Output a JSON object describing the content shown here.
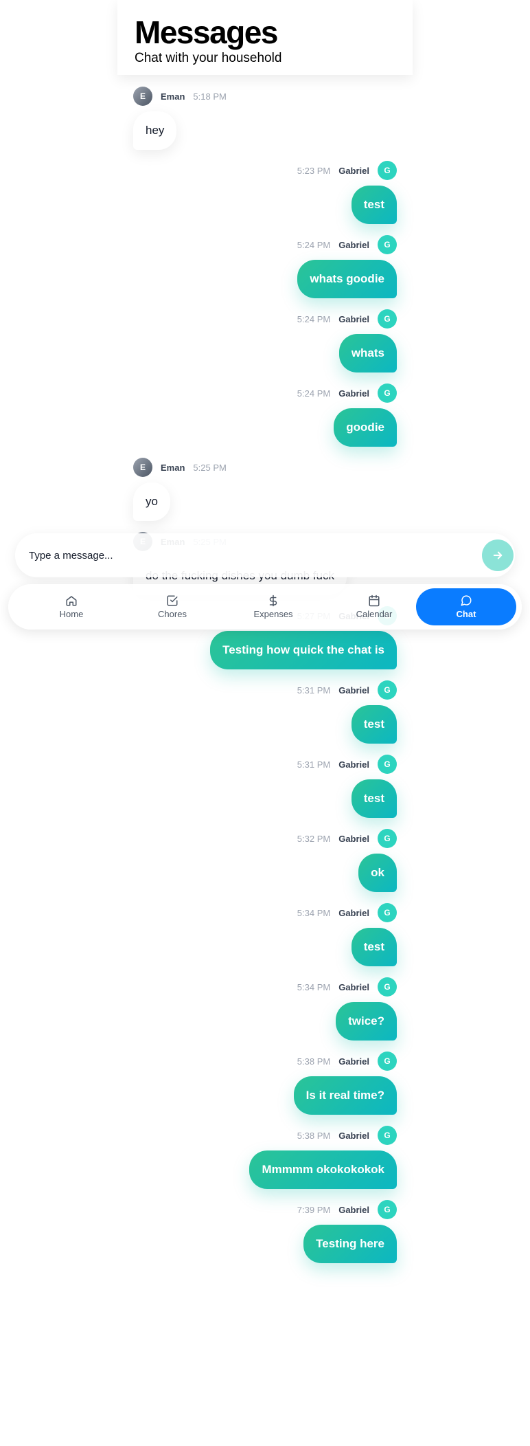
{
  "header": {
    "title": "Messages",
    "subtitle": "Chat with your household"
  },
  "messages": [
    {
      "sender": "Eman",
      "initial": "E",
      "time": "5:18 PM",
      "text": "hey",
      "side": "in"
    },
    {
      "sender": "Gabriel",
      "initial": "G",
      "time": "5:23 PM",
      "text": "test",
      "side": "out"
    },
    {
      "sender": "Gabriel",
      "initial": "G",
      "time": "5:24 PM",
      "text": "whats goodie",
      "side": "out"
    },
    {
      "sender": "Gabriel",
      "initial": "G",
      "time": "5:24 PM",
      "text": "whats",
      "side": "out"
    },
    {
      "sender": "Gabriel",
      "initial": "G",
      "time": "5:24 PM",
      "text": "goodie",
      "side": "out"
    },
    {
      "sender": "Eman",
      "initial": "E",
      "time": "5:25 PM",
      "text": "yo",
      "side": "in"
    },
    {
      "sender": "Eman",
      "initial": "E",
      "time": "5:25 PM",
      "text": "do the fucking dishes you dumb fuck",
      "side": "in"
    },
    {
      "sender": "Gabriel",
      "initial": "G",
      "time": "5:27 PM",
      "text": "Testing how quick the chat is",
      "side": "out"
    },
    {
      "sender": "Gabriel",
      "initial": "G",
      "time": "5:31 PM",
      "text": "test",
      "side": "out"
    },
    {
      "sender": "Gabriel",
      "initial": "G",
      "time": "5:31 PM",
      "text": "test",
      "side": "out"
    },
    {
      "sender": "Gabriel",
      "initial": "G",
      "time": "5:32 PM",
      "text": "ok",
      "side": "out"
    },
    {
      "sender": "Gabriel",
      "initial": "G",
      "time": "5:34 PM",
      "text": "test",
      "side": "out"
    },
    {
      "sender": "Gabriel",
      "initial": "G",
      "time": "5:34 PM",
      "text": "twice?",
      "side": "out"
    },
    {
      "sender": "Gabriel",
      "initial": "G",
      "time": "5:38 PM",
      "text": "Is it real time?",
      "side": "out"
    },
    {
      "sender": "Gabriel",
      "initial": "G",
      "time": "5:38 PM",
      "text": "Mmmmm okokokokok",
      "side": "out"
    },
    {
      "sender": "Gabriel",
      "initial": "G",
      "time": "7:39 PM",
      "text": "Testing here",
      "side": "out"
    }
  ],
  "composer": {
    "placeholder": "Type a message...",
    "send_icon": "arrow-right-icon"
  },
  "nav": {
    "accent_color": "#0a7cff",
    "tabs": [
      {
        "label": "Home",
        "icon": "home-icon",
        "active": false
      },
      {
        "label": "Chores",
        "icon": "check-square-icon",
        "active": false
      },
      {
        "label": "Expenses",
        "icon": "dollar-icon",
        "active": false
      },
      {
        "label": "Calendar",
        "icon": "calendar-icon",
        "active": false
      },
      {
        "label": "Chat",
        "icon": "chat-bubble-icon",
        "active": true
      }
    ]
  }
}
